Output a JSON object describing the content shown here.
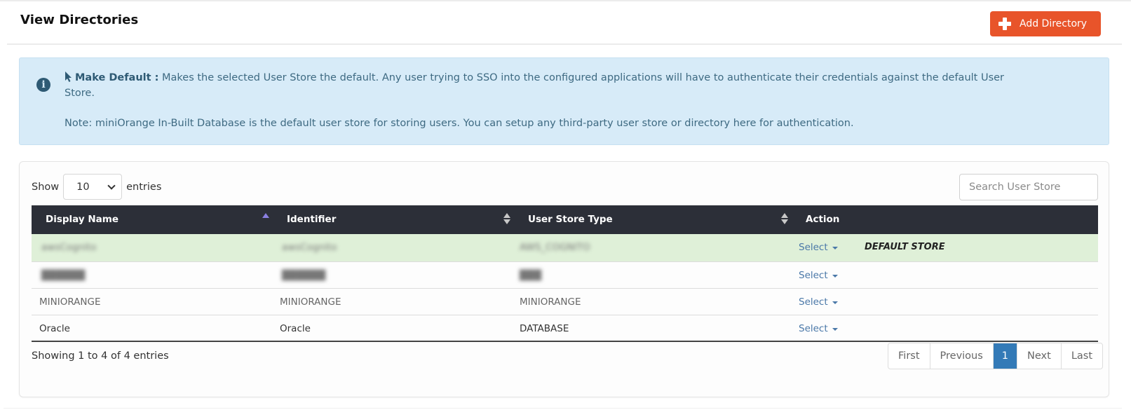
{
  "header": {
    "title": "View Directories",
    "add_button_label": "Add Directory",
    "add_button_color": "#e8542a"
  },
  "info": {
    "make_default_label": "Make Default :",
    "make_default_text": "Makes the selected User Store the default. Any user trying to SSO into the configured applications will have to authenticate their credentials against the default User Store.",
    "note_text": "Note: miniOrange In-Built Database is the default user store for storing users. You can setup any third-party user store or directory here for authentication."
  },
  "table_controls": {
    "show_label": "Show",
    "entries_label": "entries",
    "page_length": "10",
    "search_placeholder": "Search User Store"
  },
  "table": {
    "columns": [
      "Display Name",
      "Identifier",
      "User Store Type",
      "Action"
    ],
    "sorted_column": "Display Name",
    "sort_direction": "ascending",
    "rows": [
      {
        "display_name": "awsCognito",
        "identifier": "awsCognito",
        "type": "AWS_COGNITO",
        "action": "Select",
        "badge": "DEFAULT STORE",
        "redacted": true,
        "is_default": true
      },
      {
        "display_name": "██████",
        "identifier": "██████",
        "type": "███",
        "action": "Select",
        "badge": "",
        "redacted": true,
        "is_default": false
      },
      {
        "display_name": "MINIORANGE",
        "identifier": "MINIORANGE",
        "type": "MINIORANGE",
        "action": "Select",
        "badge": "",
        "redacted": false,
        "is_default": false
      },
      {
        "display_name": "Oracle",
        "identifier": "Oracle",
        "type": "DATABASE",
        "action": "Select",
        "badge": "",
        "redacted": false,
        "is_default": false
      }
    ]
  },
  "footer": {
    "summary": "Showing 1 to 4 of 4 entries",
    "pagination": {
      "first": "First",
      "previous": "Previous",
      "current_page": "1",
      "next": "Next",
      "last": "Last"
    }
  },
  "colors": {
    "accent": "#e8542a",
    "info_bg": "#d7ebf8",
    "table_header_bg": "#2c2f38",
    "default_row_bg": "#dff0d8",
    "active_page": "#337ab7",
    "link": "#4a78a8"
  }
}
